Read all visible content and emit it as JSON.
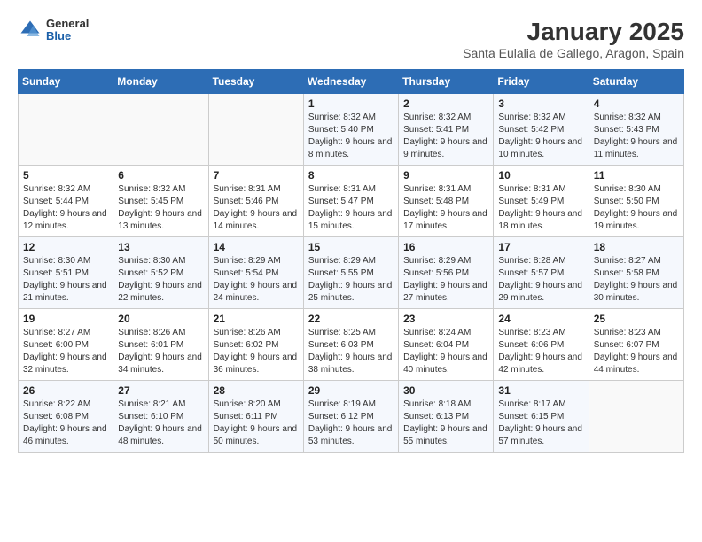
{
  "logo": {
    "general": "General",
    "blue": "Blue"
  },
  "title": "January 2025",
  "subtitle": "Santa Eulalia de Gallego, Aragon, Spain",
  "weekdays": [
    "Sunday",
    "Monday",
    "Tuesday",
    "Wednesday",
    "Thursday",
    "Friday",
    "Saturday"
  ],
  "weeks": [
    [
      {
        "day": "",
        "sunrise": "",
        "sunset": "",
        "daylight": ""
      },
      {
        "day": "",
        "sunrise": "",
        "sunset": "",
        "daylight": ""
      },
      {
        "day": "",
        "sunrise": "",
        "sunset": "",
        "daylight": ""
      },
      {
        "day": "1",
        "sunrise": "Sunrise: 8:32 AM",
        "sunset": "Sunset: 5:40 PM",
        "daylight": "Daylight: 9 hours and 8 minutes."
      },
      {
        "day": "2",
        "sunrise": "Sunrise: 8:32 AM",
        "sunset": "Sunset: 5:41 PM",
        "daylight": "Daylight: 9 hours and 9 minutes."
      },
      {
        "day": "3",
        "sunrise": "Sunrise: 8:32 AM",
        "sunset": "Sunset: 5:42 PM",
        "daylight": "Daylight: 9 hours and 10 minutes."
      },
      {
        "day": "4",
        "sunrise": "Sunrise: 8:32 AM",
        "sunset": "Sunset: 5:43 PM",
        "daylight": "Daylight: 9 hours and 11 minutes."
      }
    ],
    [
      {
        "day": "5",
        "sunrise": "Sunrise: 8:32 AM",
        "sunset": "Sunset: 5:44 PM",
        "daylight": "Daylight: 9 hours and 12 minutes."
      },
      {
        "day": "6",
        "sunrise": "Sunrise: 8:32 AM",
        "sunset": "Sunset: 5:45 PM",
        "daylight": "Daylight: 9 hours and 13 minutes."
      },
      {
        "day": "7",
        "sunrise": "Sunrise: 8:31 AM",
        "sunset": "Sunset: 5:46 PM",
        "daylight": "Daylight: 9 hours and 14 minutes."
      },
      {
        "day": "8",
        "sunrise": "Sunrise: 8:31 AM",
        "sunset": "Sunset: 5:47 PM",
        "daylight": "Daylight: 9 hours and 15 minutes."
      },
      {
        "day": "9",
        "sunrise": "Sunrise: 8:31 AM",
        "sunset": "Sunset: 5:48 PM",
        "daylight": "Daylight: 9 hours and 17 minutes."
      },
      {
        "day": "10",
        "sunrise": "Sunrise: 8:31 AM",
        "sunset": "Sunset: 5:49 PM",
        "daylight": "Daylight: 9 hours and 18 minutes."
      },
      {
        "day": "11",
        "sunrise": "Sunrise: 8:30 AM",
        "sunset": "Sunset: 5:50 PM",
        "daylight": "Daylight: 9 hours and 19 minutes."
      }
    ],
    [
      {
        "day": "12",
        "sunrise": "Sunrise: 8:30 AM",
        "sunset": "Sunset: 5:51 PM",
        "daylight": "Daylight: 9 hours and 21 minutes."
      },
      {
        "day": "13",
        "sunrise": "Sunrise: 8:30 AM",
        "sunset": "Sunset: 5:52 PM",
        "daylight": "Daylight: 9 hours and 22 minutes."
      },
      {
        "day": "14",
        "sunrise": "Sunrise: 8:29 AM",
        "sunset": "Sunset: 5:54 PM",
        "daylight": "Daylight: 9 hours and 24 minutes."
      },
      {
        "day": "15",
        "sunrise": "Sunrise: 8:29 AM",
        "sunset": "Sunset: 5:55 PM",
        "daylight": "Daylight: 9 hours and 25 minutes."
      },
      {
        "day": "16",
        "sunrise": "Sunrise: 8:29 AM",
        "sunset": "Sunset: 5:56 PM",
        "daylight": "Daylight: 9 hours and 27 minutes."
      },
      {
        "day": "17",
        "sunrise": "Sunrise: 8:28 AM",
        "sunset": "Sunset: 5:57 PM",
        "daylight": "Daylight: 9 hours and 29 minutes."
      },
      {
        "day": "18",
        "sunrise": "Sunrise: 8:27 AM",
        "sunset": "Sunset: 5:58 PM",
        "daylight": "Daylight: 9 hours and 30 minutes."
      }
    ],
    [
      {
        "day": "19",
        "sunrise": "Sunrise: 8:27 AM",
        "sunset": "Sunset: 6:00 PM",
        "daylight": "Daylight: 9 hours and 32 minutes."
      },
      {
        "day": "20",
        "sunrise": "Sunrise: 8:26 AM",
        "sunset": "Sunset: 6:01 PM",
        "daylight": "Daylight: 9 hours and 34 minutes."
      },
      {
        "day": "21",
        "sunrise": "Sunrise: 8:26 AM",
        "sunset": "Sunset: 6:02 PM",
        "daylight": "Daylight: 9 hours and 36 minutes."
      },
      {
        "day": "22",
        "sunrise": "Sunrise: 8:25 AM",
        "sunset": "Sunset: 6:03 PM",
        "daylight": "Daylight: 9 hours and 38 minutes."
      },
      {
        "day": "23",
        "sunrise": "Sunrise: 8:24 AM",
        "sunset": "Sunset: 6:04 PM",
        "daylight": "Daylight: 9 hours and 40 minutes."
      },
      {
        "day": "24",
        "sunrise": "Sunrise: 8:23 AM",
        "sunset": "Sunset: 6:06 PM",
        "daylight": "Daylight: 9 hours and 42 minutes."
      },
      {
        "day": "25",
        "sunrise": "Sunrise: 8:23 AM",
        "sunset": "Sunset: 6:07 PM",
        "daylight": "Daylight: 9 hours and 44 minutes."
      }
    ],
    [
      {
        "day": "26",
        "sunrise": "Sunrise: 8:22 AM",
        "sunset": "Sunset: 6:08 PM",
        "daylight": "Daylight: 9 hours and 46 minutes."
      },
      {
        "day": "27",
        "sunrise": "Sunrise: 8:21 AM",
        "sunset": "Sunset: 6:10 PM",
        "daylight": "Daylight: 9 hours and 48 minutes."
      },
      {
        "day": "28",
        "sunrise": "Sunrise: 8:20 AM",
        "sunset": "Sunset: 6:11 PM",
        "daylight": "Daylight: 9 hours and 50 minutes."
      },
      {
        "day": "29",
        "sunrise": "Sunrise: 8:19 AM",
        "sunset": "Sunset: 6:12 PM",
        "daylight": "Daylight: 9 hours and 53 minutes."
      },
      {
        "day": "30",
        "sunrise": "Sunrise: 8:18 AM",
        "sunset": "Sunset: 6:13 PM",
        "daylight": "Daylight: 9 hours and 55 minutes."
      },
      {
        "day": "31",
        "sunrise": "Sunrise: 8:17 AM",
        "sunset": "Sunset: 6:15 PM",
        "daylight": "Daylight: 9 hours and 57 minutes."
      },
      {
        "day": "",
        "sunrise": "",
        "sunset": "",
        "daylight": ""
      }
    ]
  ]
}
